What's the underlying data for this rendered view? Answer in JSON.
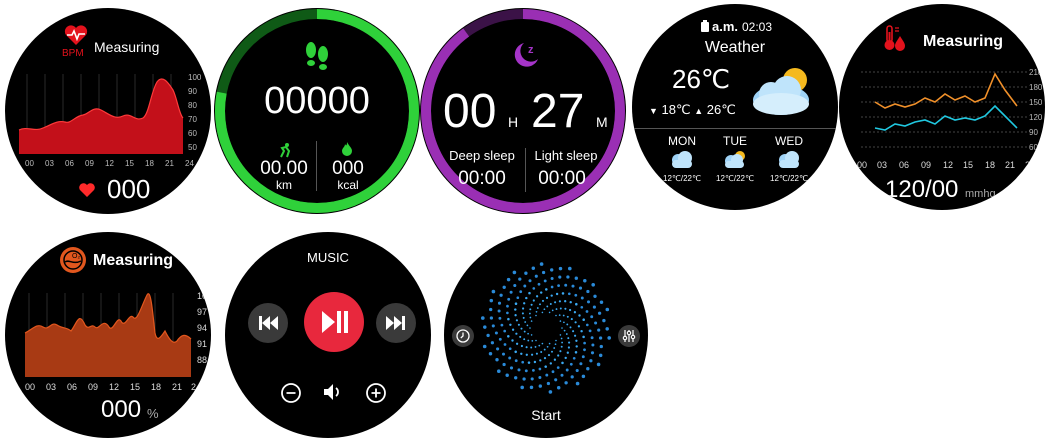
{
  "heart": {
    "title": "Measuring",
    "unit_label": "BPM",
    "value": "000",
    "y_ticks": [
      "100",
      "90",
      "80",
      "70",
      "60",
      "50"
    ],
    "x_ticks": [
      "00",
      "03",
      "06",
      "09",
      "12",
      "15",
      "18",
      "21",
      "24"
    ],
    "accent": "#e3121c"
  },
  "steps": {
    "count": "00000",
    "distance": "00.00",
    "distance_unit": "km",
    "calories": "000",
    "calories_unit": "kcal",
    "ring_color": "#2fd13a",
    "progress": 0.78
  },
  "sleep": {
    "hours": "00",
    "hours_unit": "H",
    "minutes": "27",
    "minutes_unit": "M",
    "deep_label": "Deep sleep",
    "deep_value": "00:00",
    "light_label": "Light sleep",
    "light_value": "00:00",
    "ring_color": "#9a2fb4",
    "progress": 0.9
  },
  "weather": {
    "ampm": "a.m.",
    "time": "02:03",
    "title": "Weather",
    "temp": "26℃",
    "low": "18℃",
    "high": "26℃",
    "forecast": [
      {
        "day": "MON",
        "range": "12℃/22℃",
        "icon": "cloud-icon"
      },
      {
        "day": "TUE",
        "range": "12℃/22℃",
        "icon": "partly-cloudy-icon"
      },
      {
        "day": "WED",
        "range": "12℃/22℃",
        "icon": "cloud-icon"
      }
    ]
  },
  "blood_pressure": {
    "title": "Measuring",
    "value": "120/00",
    "unit": "mmhg",
    "y_ticks": [
      "210",
      "180",
      "150",
      "120",
      "90",
      "60"
    ],
    "x_ticks": [
      "00",
      "03",
      "06",
      "09",
      "12",
      "15",
      "18",
      "21",
      "24"
    ],
    "systolic_color": "#f0902a",
    "diastolic_color": "#20c8e0"
  },
  "spo2": {
    "title": "Measuring",
    "value": "000",
    "unit": "%",
    "y_ticks": [
      "100",
      "97",
      "94",
      "91",
      "88"
    ],
    "x_ticks": [
      "00",
      "03",
      "06",
      "09",
      "12",
      "15",
      "18",
      "21",
      "24"
    ],
    "accent": "#e2571e"
  },
  "music": {
    "title": "MUSIC"
  },
  "breathe": {
    "start_label": "Start"
  }
}
